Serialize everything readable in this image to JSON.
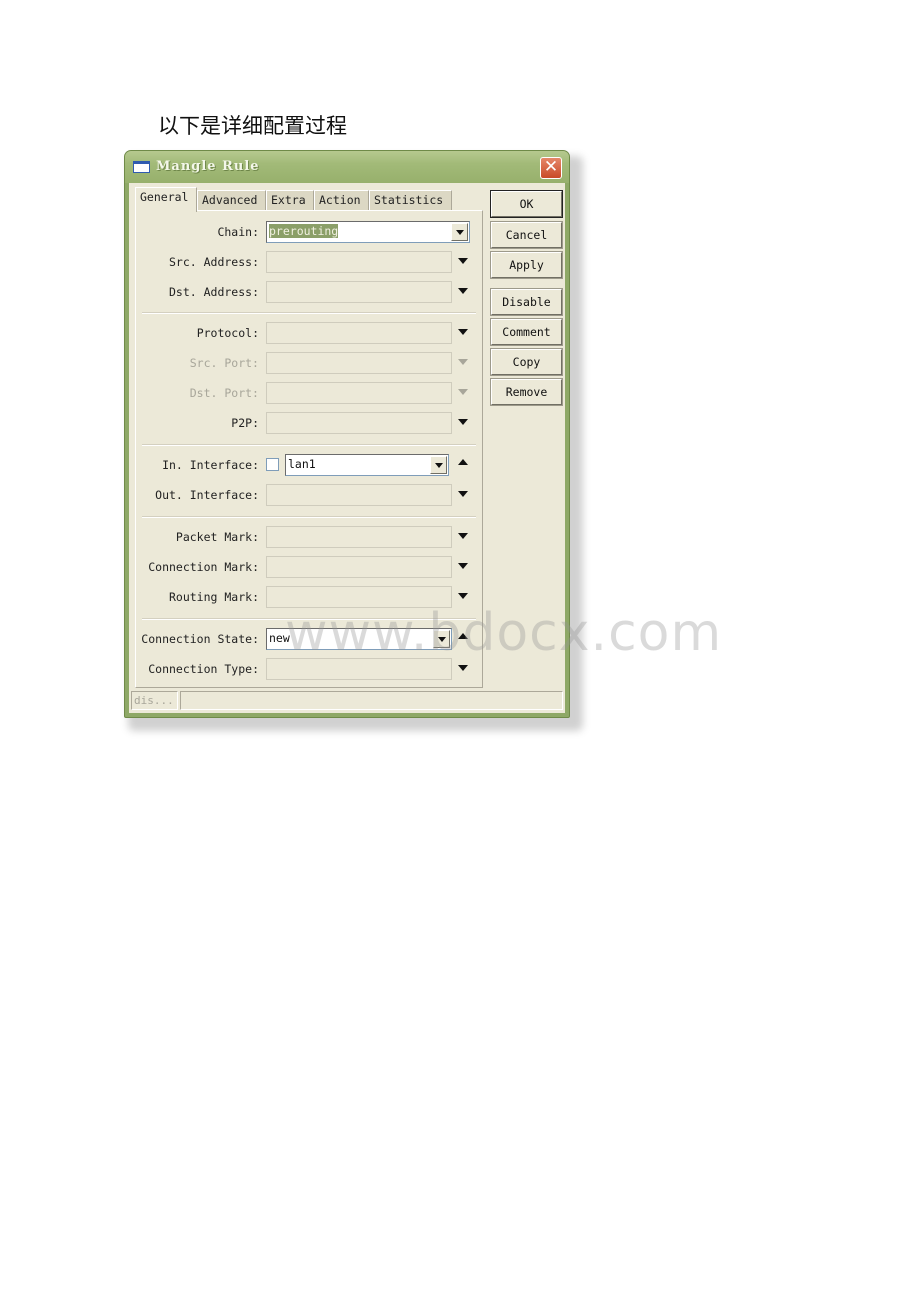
{
  "page": {
    "heading": "以下是详细配置过程",
    "watermark": "www.bdocx.com"
  },
  "window": {
    "title": "Mangle Rule",
    "icon": "window-icon",
    "close_icon": "close-icon",
    "colors": {
      "titlebar": "#a2ba78",
      "client": "#ece9d8",
      "close": "#c94a27",
      "selection": "#8b9f68"
    }
  },
  "tabs": [
    {
      "label": "General",
      "active": true
    },
    {
      "label": "Advanced",
      "active": false
    },
    {
      "label": "Extra",
      "active": false
    },
    {
      "label": "Action",
      "active": false
    },
    {
      "label": "Statistics",
      "active": false
    }
  ],
  "fields": {
    "chain": {
      "label": "Chain:",
      "value": "prerouting"
    },
    "src_address": {
      "label": "Src. Address:",
      "value": ""
    },
    "dst_address": {
      "label": "Dst. Address:",
      "value": ""
    },
    "protocol": {
      "label": "Protocol:",
      "value": ""
    },
    "src_port": {
      "label": "Src. Port:",
      "value": "",
      "disabled": true
    },
    "dst_port": {
      "label": "Dst. Port:",
      "value": "",
      "disabled": true
    },
    "p2p": {
      "label": "P2P:",
      "value": ""
    },
    "in_interface": {
      "label": "In. Interface:",
      "value": "lan1",
      "negate_checked": false
    },
    "out_interface": {
      "label": "Out. Interface:",
      "value": ""
    },
    "packet_mark": {
      "label": "Packet Mark:",
      "value": ""
    },
    "connection_mark": {
      "label": "Connection Mark:",
      "value": ""
    },
    "routing_mark": {
      "label": "Routing Mark:",
      "value": ""
    },
    "connection_state": {
      "label": "Connection State:",
      "value": "new"
    },
    "connection_type": {
      "label": "Connection Type:",
      "value": ""
    }
  },
  "buttons": {
    "ok": "OK",
    "cancel": "Cancel",
    "apply": "Apply",
    "disable": "Disable",
    "comment": "Comment",
    "copy": "Copy",
    "remove": "Remove"
  },
  "status": {
    "state": "dis...",
    "message": ""
  }
}
